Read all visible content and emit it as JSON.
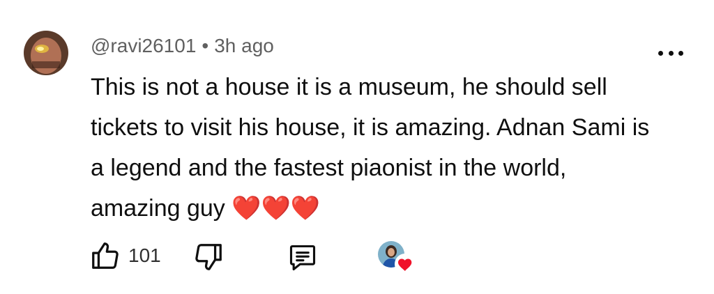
{
  "comment": {
    "author": "@ravi26101",
    "separator": "•",
    "timestamp": "3h ago",
    "text": "This is not a house it is a museum, he should sell tickets to visit his house, it is amazing. Adnan Sami is a legend and the fastest piaonist in the world, amazing guy",
    "emoji_hearts": [
      "❤️",
      "❤️",
      "❤️"
    ]
  },
  "actions": {
    "like_count": "101",
    "icons": {
      "like": "thumbs-up-icon",
      "dislike": "thumbs-down-icon",
      "reply": "comment-icon",
      "more": "more-vertical-dots-icon",
      "creator_heart": "creator-heart-icon"
    }
  },
  "colors": {
    "text": "#0f0f0f",
    "meta": "#606060",
    "heart": "#e52222"
  }
}
